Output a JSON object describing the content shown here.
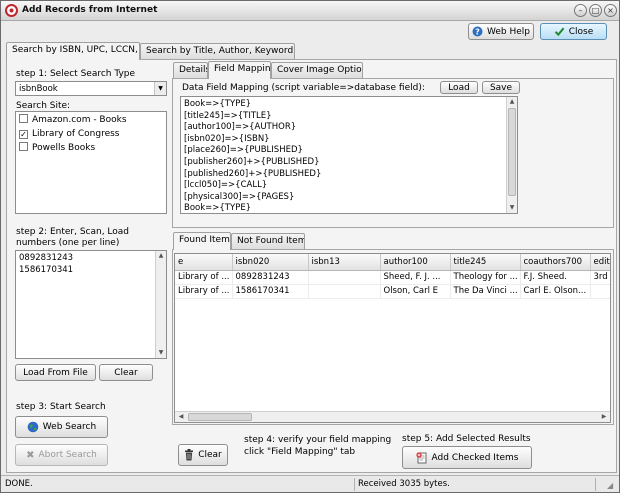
{
  "window": {
    "title": "Add Records from Internet"
  },
  "top_buttons": {
    "help_label": "Web Help",
    "close_label": "Close"
  },
  "main_tabs": [
    {
      "label": "Search by ISBN, UPC, LCCN, ..."
    },
    {
      "label": "Search by Title, Author, Keyword, ..."
    }
  ],
  "left": {
    "step1_label": "step 1: Select Search Type",
    "search_type_value": "isbnBook",
    "search_site_label": "Search Site:",
    "sites": [
      {
        "label": "Amazon.com - Books",
        "checked": false
      },
      {
        "label": "Library of Congress",
        "checked": true
      },
      {
        "label": "Powells Books",
        "checked": false
      }
    ],
    "step2_label_line1": "step 2: Enter, Scan, Load",
    "step2_label_line2": "numbers (one per line)",
    "numbers": [
      "0892831243",
      "1586170341"
    ],
    "load_file_label": "Load From File",
    "clear_label": "Clear",
    "step3_label": "step 3: Start Search",
    "web_search_label": "Web Search",
    "abort_search_label": "Abort Search"
  },
  "right_tabs": [
    {
      "label": "Details"
    },
    {
      "label": "Field Mapping"
    },
    {
      "label": "Cover Image Options"
    }
  ],
  "mapping": {
    "title": "Data Field Mapping (script variable=>database field):",
    "load_label": "Load",
    "save_label": "Save",
    "lines": [
      "Book=>{TYPE}",
      "[title245]=>{TITLE}",
      "[author100]=>{AUTHOR}",
      "[isbn020]=>{ISBN}",
      "[place260]=>{PUBLISHED}",
      "[publisher260]+>{PUBLISHED}",
      "[published260]+>{PUBLISHED}",
      "[lccl050]=>{CALL}",
      "[physical300]=>{PAGES}",
      "Book=>{TYPE}"
    ]
  },
  "result_tabs": [
    {
      "label": "Found Items"
    },
    {
      "label": "Not Found Items"
    }
  ],
  "results": {
    "columns": [
      "e",
      "isbn020",
      "isbn13",
      "author100",
      "title245",
      "coauthors700",
      "editi"
    ],
    "rows": [
      [
        "Library of ...",
        "0892831243",
        "",
        "Sheed, F. J. ...",
        "Theology for ...",
        "F.J. Sheed.",
        "3rd"
      ],
      [
        "Library of ...",
        "1586170341",
        "",
        "Olson, Carl E",
        "The Da Vinci ...",
        "Carl E. Olson...",
        ""
      ]
    ]
  },
  "bottom": {
    "clear_label": "Clear",
    "step4_line1": "step 4: verify your field mapping",
    "step4_line2": "click \"Field Mapping\" tab",
    "step5_label": "step 5: Add Selected Results",
    "add_checked_label": "Add Checked Items"
  },
  "status": {
    "left": "DONE.",
    "right": "Received 3035 bytes."
  }
}
